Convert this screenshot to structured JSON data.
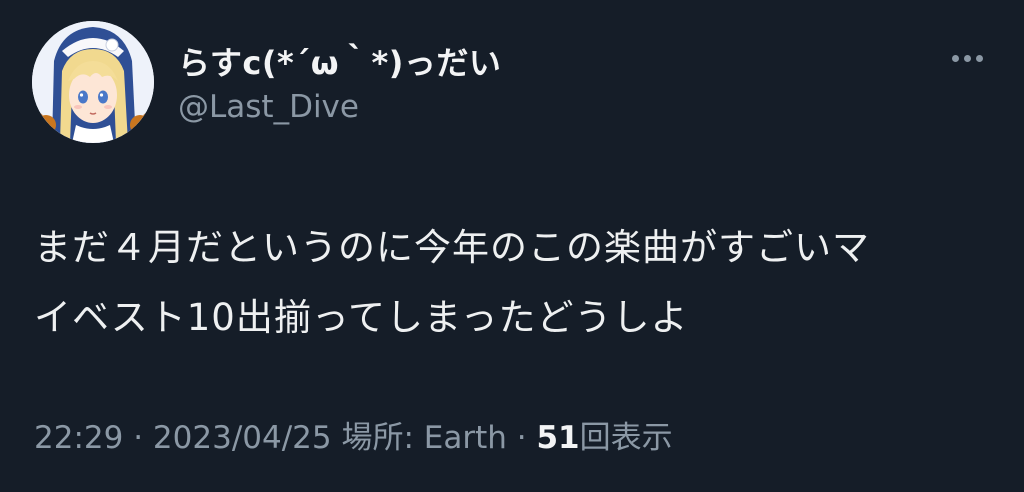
{
  "user": {
    "display_name": "らすc(*´ω｀*)っだい",
    "handle": "@Last_Dive",
    "avatar_icon": "anime-girl-avatar"
  },
  "tweet": {
    "text_line1": "まだ４月だというのに今年のこの楽曲がすごいマ",
    "text_line2": "イベスト10出揃ってしまったどうしよ"
  },
  "meta": {
    "time": "22:29",
    "separator": "·",
    "date": "2023/04/25",
    "location": "場所: Earth",
    "views_count": "51",
    "views_label": "回表示"
  },
  "icons": {
    "more": "more-horizontal-icon"
  },
  "colors": {
    "background": "#151d28",
    "primary_text": "#e7e9ea",
    "secondary_text": "#8b98a5"
  }
}
